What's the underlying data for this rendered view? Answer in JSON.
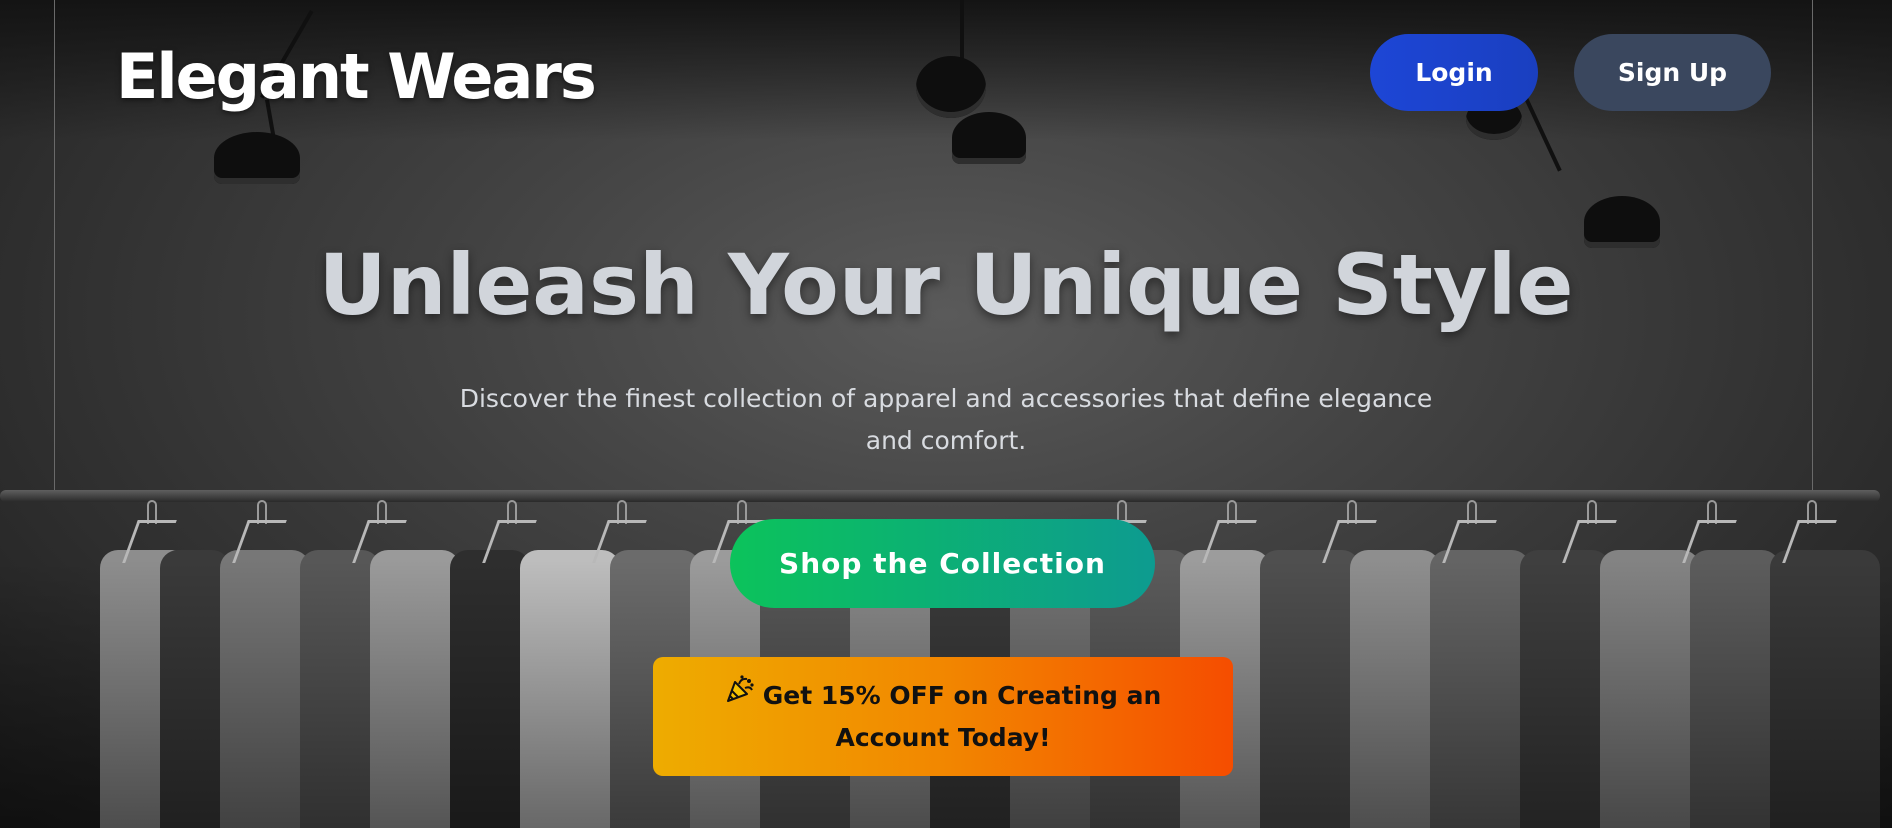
{
  "brand": {
    "name": "Elegant Wears"
  },
  "nav": {
    "login_label": "Login",
    "signup_label": "Sign Up"
  },
  "hero": {
    "headline": "Unleash Your Unique Style",
    "subheadline": "Discover the finest collection of apparel and accessories that define elegance and comfort.",
    "cta_label": "Shop the Collection"
  },
  "promo": {
    "icon": "party-popper-icon",
    "line1": "Get 15% OFF on Creating an",
    "line2": "Account Today!"
  },
  "colors": {
    "login_bg": "#1d46d6",
    "signup_bg": "#3a475e",
    "cta_start": "#0cc35b",
    "cta_end": "#0d9b90",
    "promo_start": "#eeac00",
    "promo_end": "#f54d00"
  }
}
